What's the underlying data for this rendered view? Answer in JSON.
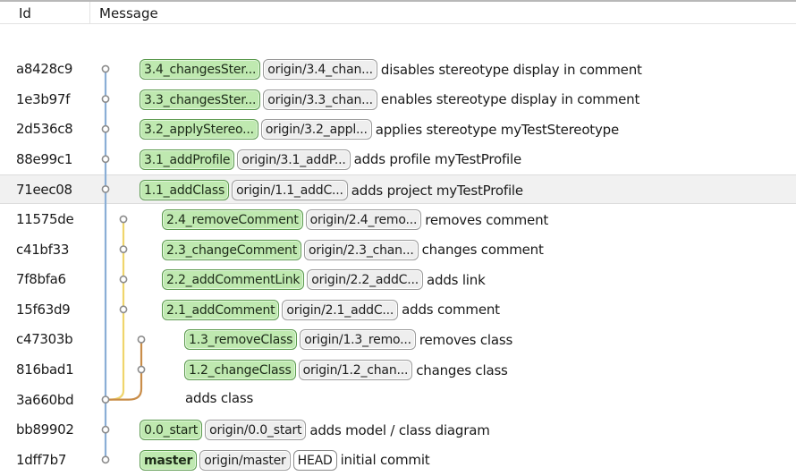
{
  "header": {
    "col_id": "Id",
    "col_message": "Message"
  },
  "colors": {
    "lane_main": "#8aaed6",
    "lane_second": "#efd56c",
    "lane_third": "#c98d49",
    "local_bg": "#bfe9b0",
    "remote_bg": "#eeeeee"
  },
  "rows": [
    {
      "id": "a8428c9",
      "refs": [
        {
          "label": "3.4_changesSter...",
          "kind": "local"
        },
        {
          "label": "origin/3.4_chan...",
          "kind": "remote"
        }
      ],
      "message": "disables stereotype display in comment"
    },
    {
      "id": "1e3b97f",
      "refs": [
        {
          "label": "3.3_changesSter...",
          "kind": "local"
        },
        {
          "label": "origin/3.3_chan...",
          "kind": "remote"
        }
      ],
      "message": "enables stereotype display in comment"
    },
    {
      "id": "2d536c8",
      "refs": [
        {
          "label": "3.2_applyStereo...",
          "kind": "local"
        },
        {
          "label": "origin/3.2_appl...",
          "kind": "remote"
        }
      ],
      "message": "applies stereotype myTestStereotype"
    },
    {
      "id": "88e99c1",
      "refs": [
        {
          "label": "3.1_addProfile",
          "kind": "local"
        },
        {
          "label": "origin/3.1_addP...",
          "kind": "remote"
        }
      ],
      "message": "adds profile myTestProfile"
    },
    {
      "id": "71eec08",
      "refs": [
        {
          "label": "1.1_addClass",
          "kind": "local"
        },
        {
          "label": "origin/1.1_addC...",
          "kind": "remote"
        }
      ],
      "message": "adds project myTestProfile",
      "selected": true
    },
    {
      "id": "11575de",
      "refs": [
        {
          "label": "2.4_removeComment",
          "kind": "local"
        },
        {
          "label": "origin/2.4_remo...",
          "kind": "remote"
        }
      ],
      "message": "removes comment"
    },
    {
      "id": "c41bf33",
      "refs": [
        {
          "label": "2.3_changeComment",
          "kind": "local"
        },
        {
          "label": "origin/2.3_chan...",
          "kind": "remote"
        }
      ],
      "message": "changes comment"
    },
    {
      "id": "7f8bfa6",
      "refs": [
        {
          "label": "2.2_addCommentLink",
          "kind": "local"
        },
        {
          "label": "origin/2.2_addC...",
          "kind": "remote"
        }
      ],
      "message": "adds link"
    },
    {
      "id": "15f63d9",
      "refs": [
        {
          "label": "2.1_addComment",
          "kind": "local"
        },
        {
          "label": "origin/2.1_addC...",
          "kind": "remote"
        }
      ],
      "message": "adds comment"
    },
    {
      "id": "c47303b",
      "refs": [
        {
          "label": "1.3_removeClass",
          "kind": "local"
        },
        {
          "label": "origin/1.3_remo...",
          "kind": "remote"
        }
      ],
      "message": "removes class"
    },
    {
      "id": "816bad1",
      "refs": [
        {
          "label": "1.2_changeClass",
          "kind": "local"
        },
        {
          "label": "origin/1.2_chan...",
          "kind": "remote"
        }
      ],
      "message": "changes class"
    },
    {
      "id": "3a660bd",
      "refs": [],
      "message": "adds class"
    },
    {
      "id": "bb89902",
      "refs": [
        {
          "label": "0.0_start",
          "kind": "local"
        },
        {
          "label": "origin/0.0_start",
          "kind": "remote"
        }
      ],
      "message": "adds model / class diagram"
    },
    {
      "id": "1dff7b7",
      "refs": [
        {
          "label": "master",
          "kind": "local",
          "bold": true
        },
        {
          "label": "origin/master",
          "kind": "remote"
        },
        {
          "label": "HEAD",
          "kind": "head"
        }
      ],
      "message": "initial commit"
    }
  ]
}
